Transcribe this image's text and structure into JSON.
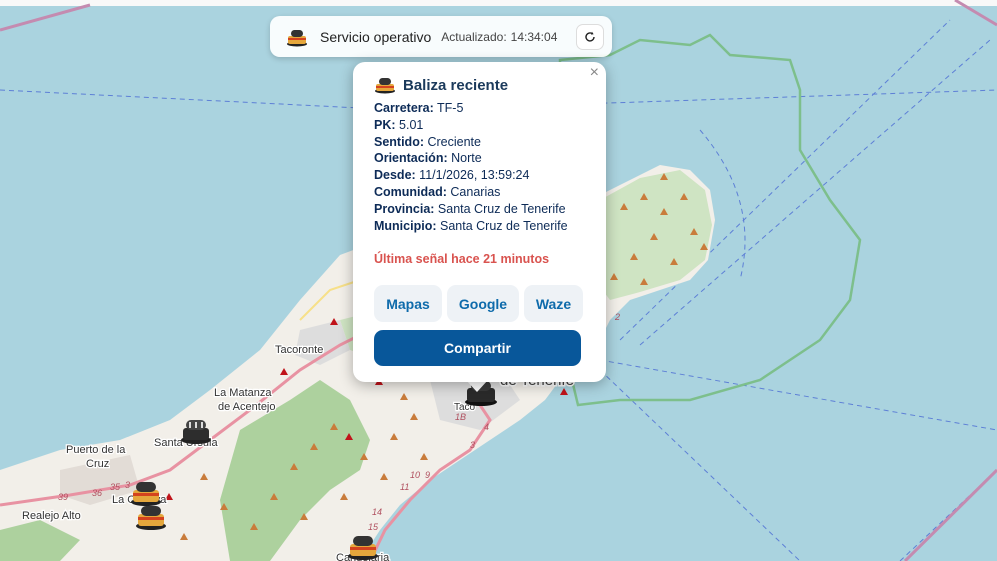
{
  "status": {
    "text": "Servicio operativo",
    "updated_label": "Actualizado:",
    "updated_time": "14:34:04",
    "refresh_icon": "refresh-icon"
  },
  "popup": {
    "title": "Baliza reciente",
    "fields": [
      {
        "label": "Carretera:",
        "value": "TF-5"
      },
      {
        "label": "PK:",
        "value": "5.01"
      },
      {
        "label": "Sentido:",
        "value": "Creciente"
      },
      {
        "label": "Orientación:",
        "value": "Norte"
      },
      {
        "label": "Desde:",
        "value": "11/1/2026, 13:59:24"
      },
      {
        "label": "Comunidad:",
        "value": "Canarias"
      },
      {
        "label": "Provincia:",
        "value": "Santa Cruz de Tenerife"
      },
      {
        "label": "Municipio:",
        "value": "Santa Cruz de Tenerife"
      }
    ],
    "signal": "Última señal hace 21 minutos",
    "buttons": {
      "maps": "Mapas",
      "google": "Google",
      "waze": "Waze"
    },
    "share": "Compartir",
    "close": "×"
  },
  "map": {
    "places": {
      "tacoronte": "Tacoronte",
      "la_matanza": "La Matanza",
      "de_acentejo": "de Acentejo",
      "santa_ursula": "Santa Úrsula",
      "puerto_1": "Puerto de la",
      "puerto_2": "Cruz",
      "la_orotava": "La Orotava",
      "realejo": "Realejo Alto",
      "candelaria": "Candelaria",
      "santa_cruz_partial": "de Tenerife",
      "taco": "Taco"
    },
    "roads": [
      "39",
      "36",
      "35",
      "3",
      "1B",
      "4",
      "3",
      "10",
      "9",
      "11",
      "14",
      "15",
      "2"
    ]
  },
  "colors": {
    "sea": "#aad3df",
    "land": "#f2efe9",
    "park": "#add19e",
    "accent": "#08579a",
    "alert": "#d9534f"
  }
}
